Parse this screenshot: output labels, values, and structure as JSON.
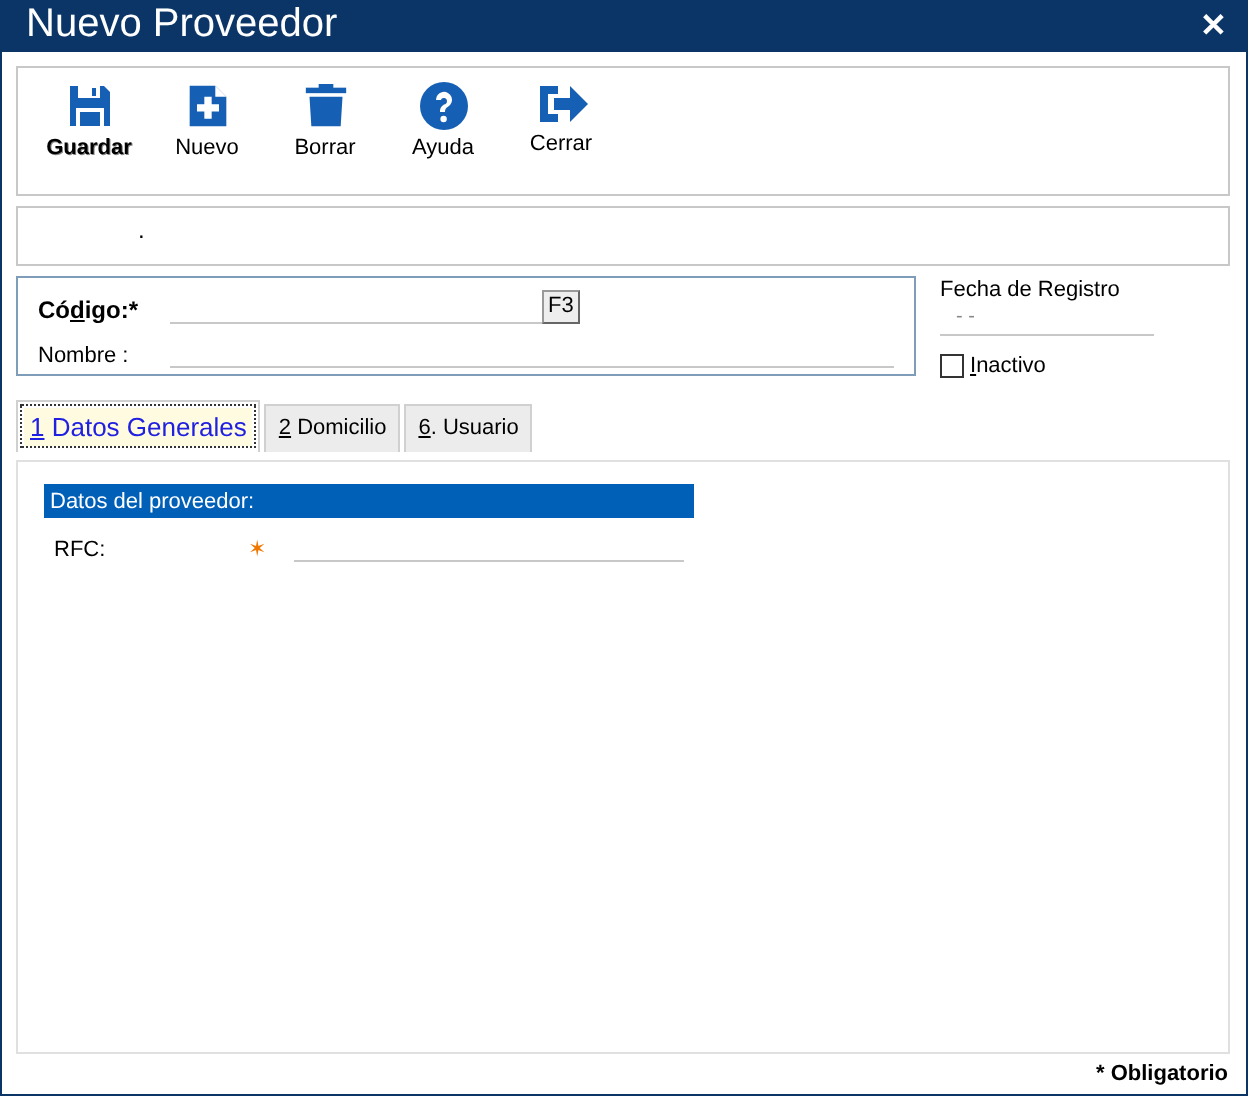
{
  "window": {
    "title": "Nuevo Proveedor",
    "close": "✕"
  },
  "toolbar": [
    {
      "kind": "save",
      "label": "Guardar",
      "bold": true
    },
    {
      "kind": "new",
      "label": "Nuevo",
      "bold": false
    },
    {
      "kind": "delete",
      "label": "Borrar",
      "bold": false
    },
    {
      "kind": "help",
      "label": "Ayuda",
      "bold": false
    },
    {
      "kind": "close",
      "label": "Cerrar",
      "bold": false
    }
  ],
  "info_bar": {
    "text": "."
  },
  "form": {
    "codigo": {
      "label": {
        "before": "Có",
        "key": "d",
        "after": "igo:*"
      },
      "button": "F3"
    },
    "nombre": {
      "label": "Nombre :"
    }
  },
  "fecha_registro": {
    "label": "Fecha de Registro",
    "value": "- -"
  },
  "inactivo": {
    "label": {
      "key": "I",
      "after": "nactivo"
    },
    "checked": false
  },
  "tabs": [
    {
      "label": {
        "key": "1",
        "after": " Datos Generales"
      },
      "selected": true
    },
    {
      "label": {
        "key": "2",
        "after": " Domicilio"
      },
      "selected": false
    },
    {
      "label": {
        "key": "6",
        "after": ". Usuario"
      },
      "selected": false
    }
  ],
  "section": {
    "title": "Datos del proveedor:",
    "fields": [
      {
        "label": "RFC:",
        "required_mark": "✶"
      }
    ]
  },
  "status_bar": {
    "text": "* Obligatorio"
  }
}
